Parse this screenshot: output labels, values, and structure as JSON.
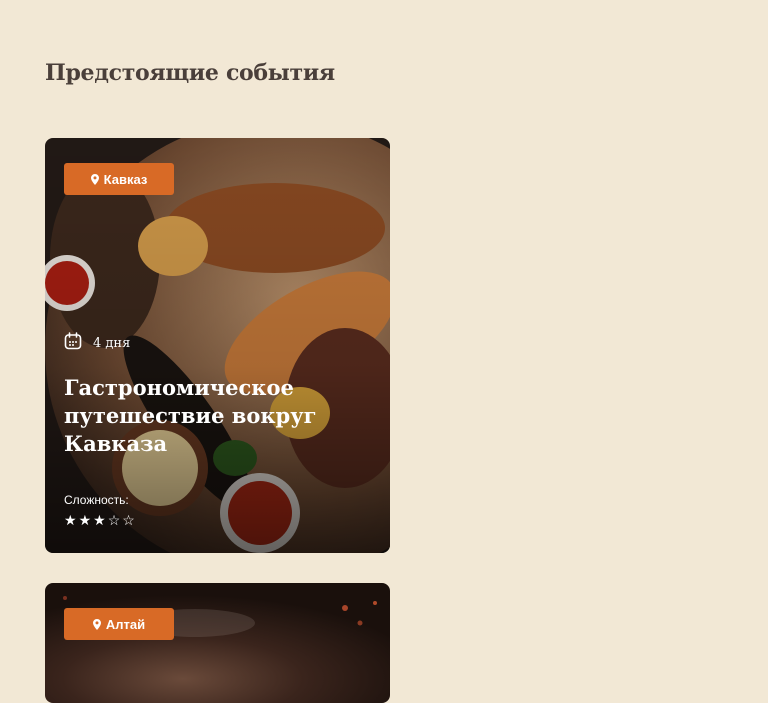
{
  "section": {
    "title": "Предстоящие события"
  },
  "events": [
    {
      "location": "Кавказ",
      "duration": "4 дня",
      "title": "Гастрономическое путешествие вокруг Кавказа",
      "difficulty_label": "Сложность:",
      "difficulty": 3,
      "difficulty_max": 5
    },
    {
      "location": "Алтай"
    }
  ],
  "icons": {
    "location": "map-pin-icon",
    "duration": "calendar-icon",
    "rating": "star-icon"
  },
  "colors": {
    "page_bg": "#f2e8d5",
    "accent": "#d86a26",
    "title": "#4a3f3a"
  }
}
